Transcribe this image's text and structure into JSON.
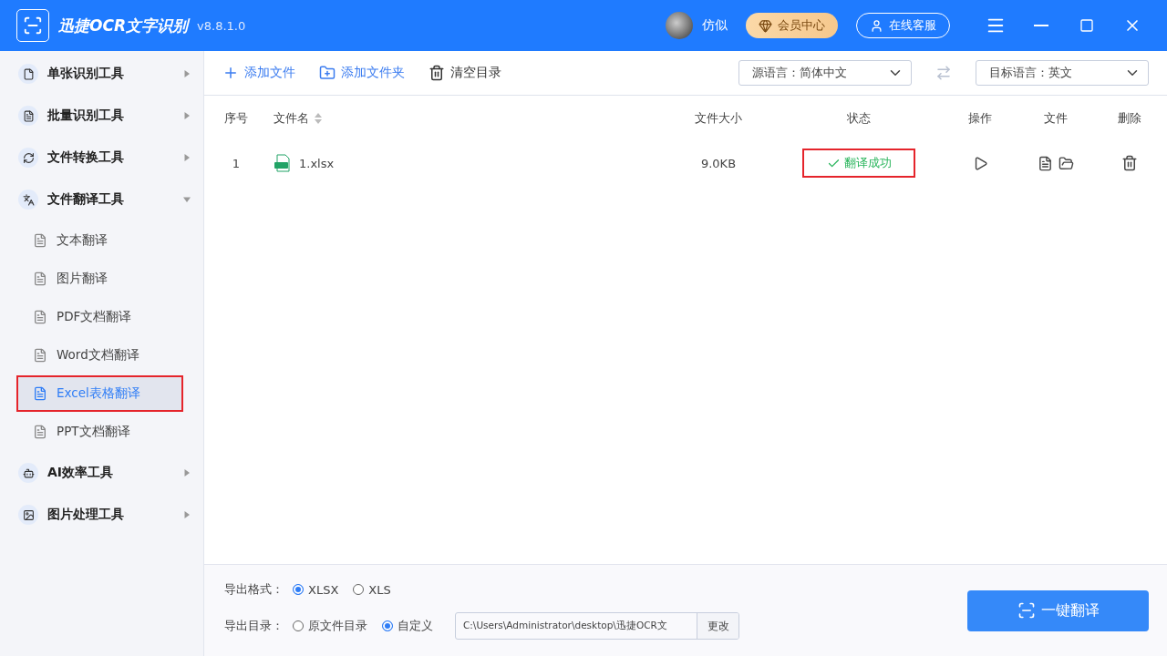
{
  "title_bar": {
    "app_name": "迅捷OCR文字识别",
    "version": "v8.8.1.0",
    "user_name": "仿似",
    "vip_label": "会员中心",
    "service_label": "在线客服"
  },
  "sidebar": {
    "items": [
      {
        "kind": "single",
        "label": "单张识别工具",
        "expanded": false
      },
      {
        "kind": "batch",
        "label": "批量识别工具",
        "expanded": false
      },
      {
        "kind": "convert",
        "label": "文件转换工具",
        "expanded": false
      },
      {
        "kind": "translate",
        "label": "文件翻译工具",
        "expanded": true,
        "children": [
          {
            "label": "文本翻译",
            "selected": false
          },
          {
            "label": "图片翻译",
            "selected": false
          },
          {
            "label": "PDF文档翻译",
            "selected": false
          },
          {
            "label": "Word文档翻译",
            "selected": false
          },
          {
            "label": "Excel表格翻译",
            "selected": true
          },
          {
            "label": "PPT文档翻译",
            "selected": false
          }
        ]
      },
      {
        "kind": "ai",
        "label": "AI效率工具",
        "expanded": false
      },
      {
        "kind": "image",
        "label": "图片处理工具",
        "expanded": false
      }
    ]
  },
  "toolbar": {
    "buttons": [
      {
        "kind": "add-file",
        "label": "添加文件"
      },
      {
        "kind": "add-folder",
        "label": "添加文件夹"
      },
      {
        "kind": "clear",
        "label": "清空目录"
      }
    ],
    "source_language": "源语言：简体中文",
    "target_language": "目标语言：英文"
  },
  "table": {
    "columns": [
      "序号",
      "文件名",
      "文件大小",
      "状态",
      "操作",
      "文件",
      "删除"
    ],
    "rows": [
      {
        "index": "1",
        "name": "1.xlsx",
        "size": "9.0KB",
        "status": "翻译成功",
        "highlighted": true
      }
    ]
  },
  "export": {
    "format_label": "导出格式：",
    "formats": [
      {
        "label": "XLSX",
        "selected": true
      },
      {
        "label": "XLS",
        "selected": false
      }
    ],
    "dir_label": "导出目录：",
    "dir_options": [
      {
        "label": "原文件目录",
        "selected": false
      },
      {
        "label": "自定义",
        "selected": true
      }
    ],
    "path": "C:\\Users\\Administrator\\desktop\\迅捷OCR文",
    "change_button": "更改",
    "translate_button": "一键翻译"
  }
}
